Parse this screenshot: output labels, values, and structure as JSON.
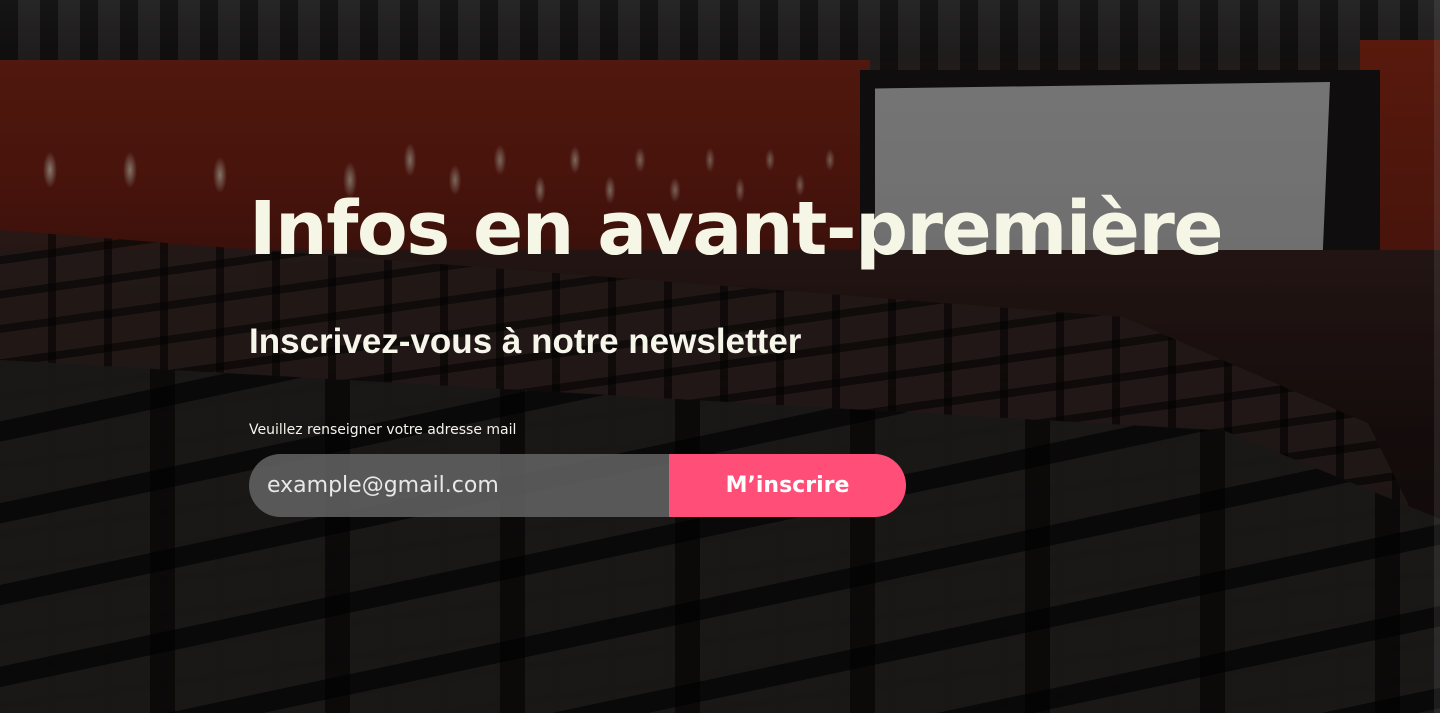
{
  "hero": {
    "title": "Infos en avant-première",
    "subtitle": "Inscrivez-vous à notre newsletter"
  },
  "newsletter": {
    "label": "Veuillez renseigner votre adresse mail",
    "email_placeholder": "example@gmail.com",
    "submit_label": "M’inscrire"
  },
  "colors": {
    "accent": "#ff4f78",
    "title_text": "#f6f6e6"
  }
}
